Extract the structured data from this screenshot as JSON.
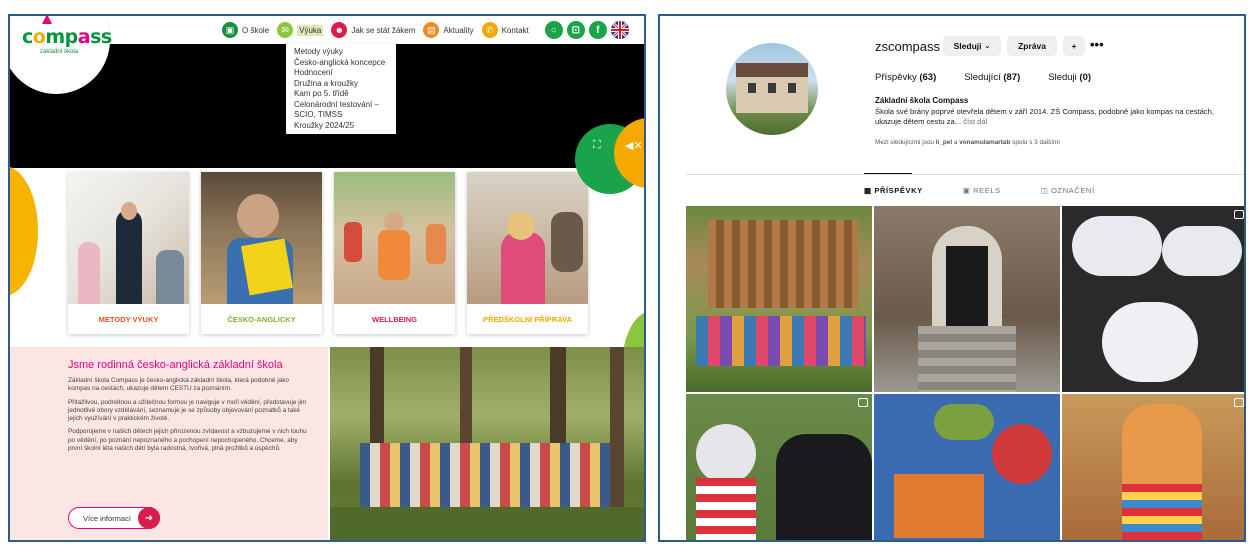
{
  "website": {
    "logo": {
      "text": "compass",
      "tagline": "základní škola"
    },
    "nav": [
      {
        "label": "O škole",
        "icon": "school-icon",
        "color": "#1a8f3e"
      },
      {
        "label": "Výuka",
        "icon": "chat-icon",
        "color": "#8cc63f"
      },
      {
        "label": "Jak se stát žákem",
        "icon": "user-icon",
        "color": "#d81c4d"
      },
      {
        "label": "Aktuality",
        "icon": "news-icon",
        "color": "#f08a24"
      },
      {
        "label": "Kontakt",
        "icon": "phone-icon",
        "color": "#f5a800"
      }
    ],
    "utility_icons": [
      {
        "icon": "search-icon",
        "color": "#1aa34a"
      },
      {
        "icon": "lock-icon",
        "color": "#1aa34a"
      },
      {
        "icon": "facebook-icon",
        "color": "#1aa34a"
      },
      {
        "icon": "uk-flag-icon",
        "color": "#1aa34a"
      }
    ],
    "dropdown": [
      "Metody výuky",
      "Česko-anglická koncepce",
      "Hodnocení",
      "Družina a kroužky",
      "Kam po 5. třídě",
      "Celonárodní testování – SCIO, TIMSS",
      "Kroužky 2024/25"
    ],
    "cards": [
      {
        "label": "METODY VÝUKY",
        "color": "#e5531a"
      },
      {
        "label": "ČESKO-ANGLICKY",
        "color": "#7bb42a"
      },
      {
        "label": "WELLBEING",
        "color": "#d81c4d"
      },
      {
        "label": "PŘEDŠKOLNÍ PŘÍPRAVA",
        "color": "#f5a800"
      }
    ],
    "about": {
      "heading": "Jsme rodinná česko-anglická základní škola",
      "p1": "Základní škola Compass je česko-anglická základní škola, která podobně jako kompas na cestách, ukazuje dětem CESTU za poznáním.",
      "p2": "Přitažlivou, podnětnou a užitečnou formou je naviguje v moři vědění, představuje jim jednotlivé obory vzdělávání, seznamuje je se způsoby objevování poznatků a také jejich využívání v praktickém životě.",
      "p3": "Podporujeme v našich dětech jejich přirozenou zvídavost a vzbuzujeme v nich touhu po vědění, po poznání nepoznaného a pochopení nepochopeného. Chceme, aby první školní léta našich dětí byla radostná, tvořivá, plná prožitků a úspěchů.",
      "button": "Více informací"
    }
  },
  "instagram": {
    "username": "zscompass",
    "buttons": {
      "follow": "Sleduji",
      "message": "Zpráva"
    },
    "stats": [
      {
        "label": "Příspěvky",
        "value": "(63)"
      },
      {
        "label": "Sledující",
        "value": "(87)"
      },
      {
        "label": "Sleduji",
        "value": "(0)"
      }
    ],
    "bio_name": "Základní škola Compass",
    "bio_text": "Škola své brány poprvé otevřela dětem v září 2014. ZŠ Compass, podobně jako kompas na cestách, ukazuje dětem cestu za...",
    "bio_more": "číst dál",
    "followers_note": {
      "prefix": "Mezi sledujícími jsou",
      "user1": "li_pel",
      "middle": "a",
      "user2": "vonamulamartab",
      "suffix": "spolu s 3 dalšími"
    },
    "tabs": [
      "PŘÍSPĚVKY",
      "REELS",
      "OZNAČENÍ"
    ]
  }
}
